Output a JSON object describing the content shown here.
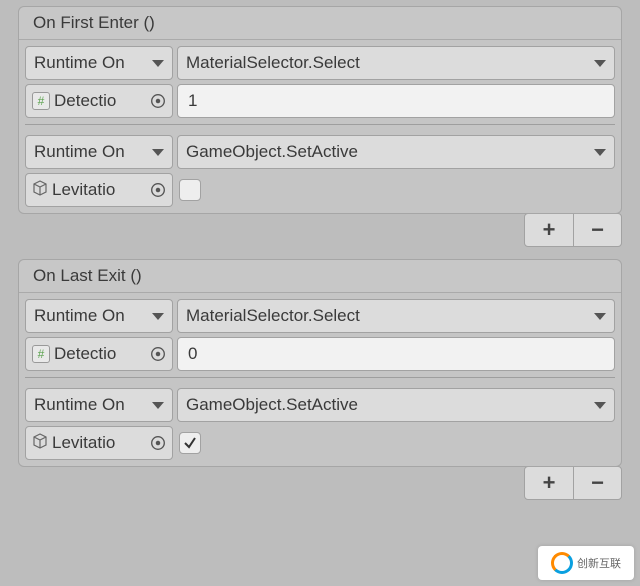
{
  "events": [
    {
      "title": "On First Enter ()",
      "entries": [
        {
          "callState": "Runtime On",
          "target": {
            "kind": "script",
            "label": "Detectio"
          },
          "method": "MaterialSelector.Select",
          "arg": {
            "type": "int",
            "value": "1"
          }
        },
        {
          "callState": "Runtime On",
          "target": {
            "kind": "gameobject",
            "label": "Levitatio"
          },
          "method": "GameObject.SetActive",
          "arg": {
            "type": "bool",
            "checked": false
          }
        }
      ]
    },
    {
      "title": "On Last Exit ()",
      "entries": [
        {
          "callState": "Runtime On",
          "target": {
            "kind": "script",
            "label": "Detectio"
          },
          "method": "MaterialSelector.Select",
          "arg": {
            "type": "int",
            "value": "0"
          }
        },
        {
          "callState": "Runtime On",
          "target": {
            "kind": "gameobject",
            "label": "Levitatio"
          },
          "method": "GameObject.SetActive",
          "arg": {
            "type": "bool",
            "checked": true
          }
        }
      ]
    }
  ],
  "watermark": "创新互联"
}
